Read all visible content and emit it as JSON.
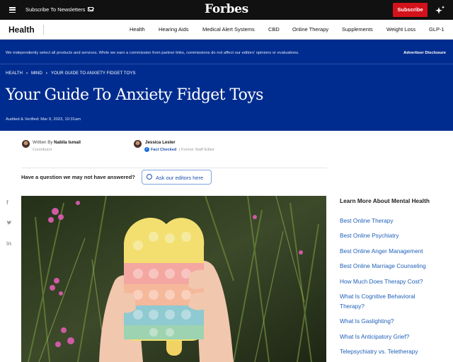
{
  "topbar": {
    "subscribe_newsletters": "Subscribe To Newsletters",
    "logo": "Forbes",
    "subscribe_button": "Subscribe",
    "icons": [
      "menu-icon",
      "mail-icon",
      "sparkle-icon"
    ]
  },
  "nav": {
    "section": "Health",
    "items": [
      {
        "label": "Health"
      },
      {
        "label": "Hearing Aids"
      },
      {
        "label": "Medical Alert Systems"
      },
      {
        "label": "CBD"
      },
      {
        "label": "Online Therapy"
      },
      {
        "label": "Supplements"
      },
      {
        "label": "Weight Loss"
      },
      {
        "label": "GLP-1"
      }
    ]
  },
  "hero": {
    "disclaimer": "We independently select all products and services. While we earn a commission from partner links, commissions do not affect our editors' opinions or evaluations.",
    "advertiser_disclosure": "Advertiser Disclosure",
    "breadcrumbs": [
      "HEALTH",
      "MIND",
      "YOUR GUIDE TO ANXIETY FIDGET TOYS"
    ],
    "title": "Your Guide To Anxiety Fidget Toys",
    "audited": "Audited & Verified: Mar 9, 2023, 10:31am",
    "bg_color": "#002c8f"
  },
  "authors": {
    "writer_prefix": "Written By",
    "writer_name": "Nabila Ismail",
    "writer_role": "Contributor",
    "checker_name": "Jessica Lester",
    "fact_checked": "Fact Checked",
    "checker_role": "Former Staff Editor"
  },
  "question": {
    "text": "Have a question we may not have answered?",
    "button": "Ask our editors here"
  },
  "social": [
    "facebook-icon",
    "twitter-icon",
    "linkedin-icon"
  ],
  "sidebar": {
    "title": "Learn More About Mental Health",
    "links": [
      "Best Online Therapy",
      "Best Online Psychiatry",
      "Best Online Anger Management",
      "Best Online Marriage Counseling",
      "How Much Does Therapy Cost?",
      "What Is Cognitive Behavioral",
      "Therapy?",
      "What Is Gaslighting?",
      "What Is Anticipatory Grief?",
      "Telepsychiatry vs. Teletherapy"
    ],
    "link_color": "#1f5fb8"
  }
}
